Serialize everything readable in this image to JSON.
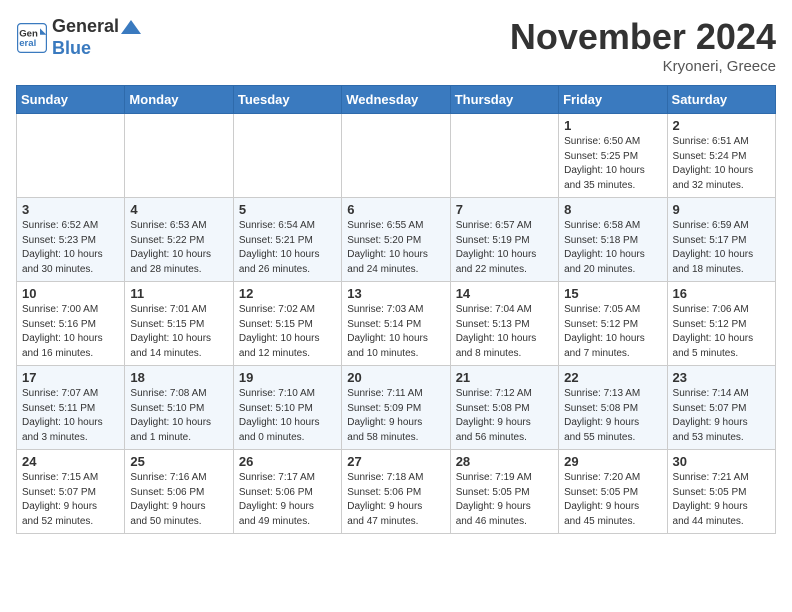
{
  "logo": {
    "line1": "General",
    "line2": "Blue"
  },
  "title": "November 2024",
  "location": "Kryoneri, Greece",
  "days_of_week": [
    "Sunday",
    "Monday",
    "Tuesday",
    "Wednesday",
    "Thursday",
    "Friday",
    "Saturday"
  ],
  "weeks": [
    [
      {
        "day": "",
        "info": ""
      },
      {
        "day": "",
        "info": ""
      },
      {
        "day": "",
        "info": ""
      },
      {
        "day": "",
        "info": ""
      },
      {
        "day": "",
        "info": ""
      },
      {
        "day": "1",
        "info": "Sunrise: 6:50 AM\nSunset: 5:25 PM\nDaylight: 10 hours\nand 35 minutes."
      },
      {
        "day": "2",
        "info": "Sunrise: 6:51 AM\nSunset: 5:24 PM\nDaylight: 10 hours\nand 32 minutes."
      }
    ],
    [
      {
        "day": "3",
        "info": "Sunrise: 6:52 AM\nSunset: 5:23 PM\nDaylight: 10 hours\nand 30 minutes."
      },
      {
        "day": "4",
        "info": "Sunrise: 6:53 AM\nSunset: 5:22 PM\nDaylight: 10 hours\nand 28 minutes."
      },
      {
        "day": "5",
        "info": "Sunrise: 6:54 AM\nSunset: 5:21 PM\nDaylight: 10 hours\nand 26 minutes."
      },
      {
        "day": "6",
        "info": "Sunrise: 6:55 AM\nSunset: 5:20 PM\nDaylight: 10 hours\nand 24 minutes."
      },
      {
        "day": "7",
        "info": "Sunrise: 6:57 AM\nSunset: 5:19 PM\nDaylight: 10 hours\nand 22 minutes."
      },
      {
        "day": "8",
        "info": "Sunrise: 6:58 AM\nSunset: 5:18 PM\nDaylight: 10 hours\nand 20 minutes."
      },
      {
        "day": "9",
        "info": "Sunrise: 6:59 AM\nSunset: 5:17 PM\nDaylight: 10 hours\nand 18 minutes."
      }
    ],
    [
      {
        "day": "10",
        "info": "Sunrise: 7:00 AM\nSunset: 5:16 PM\nDaylight: 10 hours\nand 16 minutes."
      },
      {
        "day": "11",
        "info": "Sunrise: 7:01 AM\nSunset: 5:15 PM\nDaylight: 10 hours\nand 14 minutes."
      },
      {
        "day": "12",
        "info": "Sunrise: 7:02 AM\nSunset: 5:15 PM\nDaylight: 10 hours\nand 12 minutes."
      },
      {
        "day": "13",
        "info": "Sunrise: 7:03 AM\nSunset: 5:14 PM\nDaylight: 10 hours\nand 10 minutes."
      },
      {
        "day": "14",
        "info": "Sunrise: 7:04 AM\nSunset: 5:13 PM\nDaylight: 10 hours\nand 8 minutes."
      },
      {
        "day": "15",
        "info": "Sunrise: 7:05 AM\nSunset: 5:12 PM\nDaylight: 10 hours\nand 7 minutes."
      },
      {
        "day": "16",
        "info": "Sunrise: 7:06 AM\nSunset: 5:12 PM\nDaylight: 10 hours\nand 5 minutes."
      }
    ],
    [
      {
        "day": "17",
        "info": "Sunrise: 7:07 AM\nSunset: 5:11 PM\nDaylight: 10 hours\nand 3 minutes."
      },
      {
        "day": "18",
        "info": "Sunrise: 7:08 AM\nSunset: 5:10 PM\nDaylight: 10 hours\nand 1 minute."
      },
      {
        "day": "19",
        "info": "Sunrise: 7:10 AM\nSunset: 5:10 PM\nDaylight: 10 hours\nand 0 minutes."
      },
      {
        "day": "20",
        "info": "Sunrise: 7:11 AM\nSunset: 5:09 PM\nDaylight: 9 hours\nand 58 minutes."
      },
      {
        "day": "21",
        "info": "Sunrise: 7:12 AM\nSunset: 5:08 PM\nDaylight: 9 hours\nand 56 minutes."
      },
      {
        "day": "22",
        "info": "Sunrise: 7:13 AM\nSunset: 5:08 PM\nDaylight: 9 hours\nand 55 minutes."
      },
      {
        "day": "23",
        "info": "Sunrise: 7:14 AM\nSunset: 5:07 PM\nDaylight: 9 hours\nand 53 minutes."
      }
    ],
    [
      {
        "day": "24",
        "info": "Sunrise: 7:15 AM\nSunset: 5:07 PM\nDaylight: 9 hours\nand 52 minutes."
      },
      {
        "day": "25",
        "info": "Sunrise: 7:16 AM\nSunset: 5:06 PM\nDaylight: 9 hours\nand 50 minutes."
      },
      {
        "day": "26",
        "info": "Sunrise: 7:17 AM\nSunset: 5:06 PM\nDaylight: 9 hours\nand 49 minutes."
      },
      {
        "day": "27",
        "info": "Sunrise: 7:18 AM\nSunset: 5:06 PM\nDaylight: 9 hours\nand 47 minutes."
      },
      {
        "day": "28",
        "info": "Sunrise: 7:19 AM\nSunset: 5:05 PM\nDaylight: 9 hours\nand 46 minutes."
      },
      {
        "day": "29",
        "info": "Sunrise: 7:20 AM\nSunset: 5:05 PM\nDaylight: 9 hours\nand 45 minutes."
      },
      {
        "day": "30",
        "info": "Sunrise: 7:21 AM\nSunset: 5:05 PM\nDaylight: 9 hours\nand 44 minutes."
      }
    ]
  ]
}
